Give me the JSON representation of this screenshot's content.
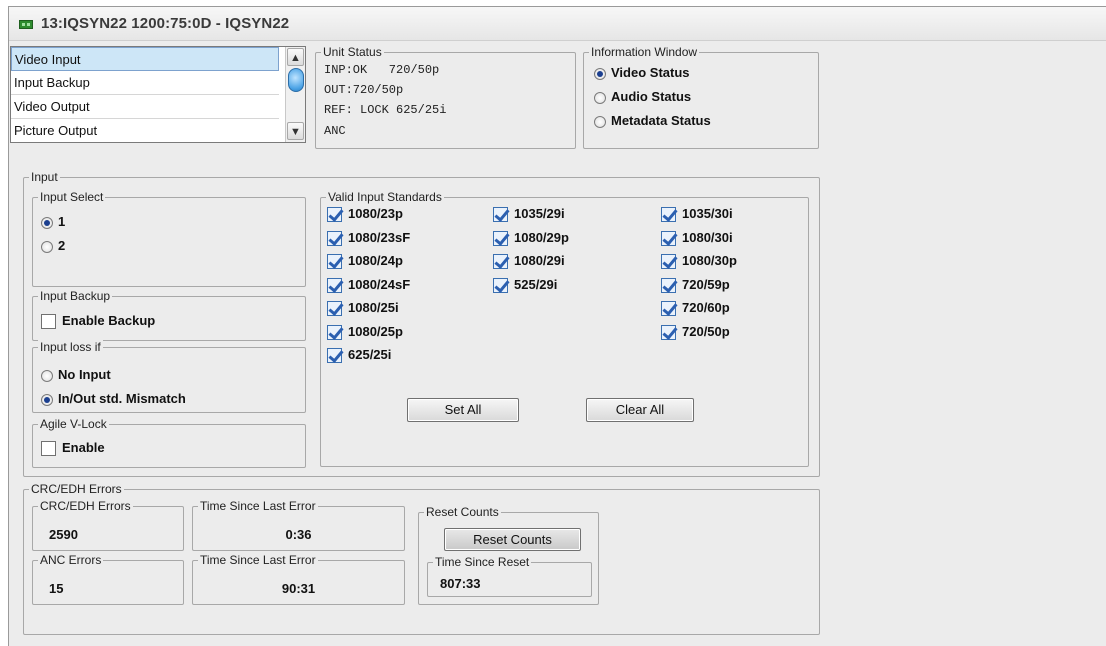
{
  "window": {
    "title": "13:IQSYN22  1200:75:0D  - IQSYN22"
  },
  "nav_list": {
    "items": [
      {
        "label": "Video Input",
        "selected": true
      },
      {
        "label": "Input Backup",
        "selected": false
      },
      {
        "label": "Video Output",
        "selected": false
      },
      {
        "label": "Picture Output",
        "selected": false
      }
    ]
  },
  "unit_status": {
    "legend": "Unit Status",
    "lines": [
      "INP:OK   720/50p",
      "OUT:720/50p",
      "REF: LOCK 625/25i",
      "ANC"
    ]
  },
  "information_window": {
    "legend": "Information Window",
    "options": [
      {
        "label": "Video Status",
        "selected": true
      },
      {
        "label": "Audio Status",
        "selected": false
      },
      {
        "label": "Metadata Status",
        "selected": false
      }
    ]
  },
  "input": {
    "legend": "Input",
    "input_select": {
      "legend": "Input Select",
      "options": [
        {
          "label": "1",
          "selected": true
        },
        {
          "label": "2",
          "selected": false
        }
      ]
    },
    "input_backup": {
      "legend": "Input Backup",
      "enable_label": "Enable Backup",
      "checked": false
    },
    "input_loss": {
      "legend": "Input  loss if",
      "options": [
        {
          "label": "No Input",
          "selected": false
        },
        {
          "label": "In/Out std. Mismatch",
          "selected": true
        }
      ]
    },
    "agile_vlock": {
      "legend": "Agile V-Lock",
      "enable_label": "Enable",
      "checked": false
    },
    "valid_standards": {
      "legend": "Valid Input Standards",
      "col1": [
        "1080/23p",
        "1080/23sF",
        "1080/24p",
        "1080/24sF",
        "1080/25i",
        "1080/25p",
        "625/25i"
      ],
      "col2": [
        "1035/29i",
        "1080/29p",
        "1080/29i",
        "525/29i"
      ],
      "col3": [
        "1035/30i",
        "1080/30i",
        "1080/30p",
        "720/59p",
        "720/60p",
        "720/50p"
      ],
      "set_all": "Set All",
      "clear_all": "Clear All"
    }
  },
  "crc": {
    "legend": "CRC/EDH Errors",
    "crc_errors": {
      "legend": "CRC/EDH Errors",
      "value": "2590"
    },
    "crc_time": {
      "legend": "Time Since Last Error",
      "value": "0:36"
    },
    "anc_errors": {
      "legend": "ANC Errors",
      "value": "15"
    },
    "anc_time": {
      "legend": "Time Since Last Error",
      "value": "90:31"
    },
    "reset": {
      "legend": "Reset Counts",
      "button": "Reset Counts",
      "since_legend": "Time Since Reset",
      "since_value": "807:33"
    }
  }
}
